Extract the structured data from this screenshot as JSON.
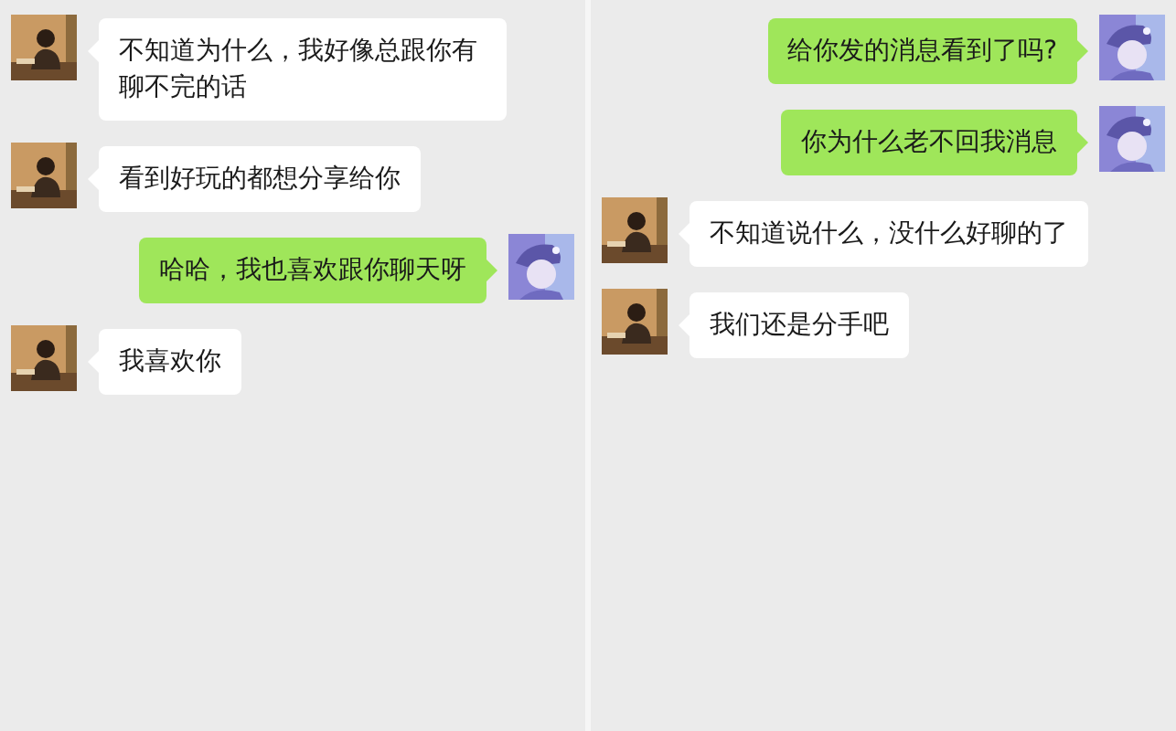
{
  "panels": [
    {
      "messages": [
        {
          "kind": "other",
          "text": "不知道为什么，我好像总跟你有聊不完的话"
        },
        {
          "kind": "other",
          "text": "看到好玩的都想分享给你"
        },
        {
          "kind": "self",
          "text": "哈哈，我也喜欢跟你聊天呀"
        },
        {
          "kind": "other",
          "text": "我喜欢你"
        }
      ]
    },
    {
      "messages": [
        {
          "kind": "self",
          "text": "给你发的消息看到了吗?"
        },
        {
          "kind": "self",
          "text": "你为什么老不回我消息"
        },
        {
          "kind": "other",
          "text": "不知道说什么，没什么好聊的了"
        },
        {
          "kind": "other",
          "text": "我们还是分手吧"
        }
      ]
    }
  ]
}
